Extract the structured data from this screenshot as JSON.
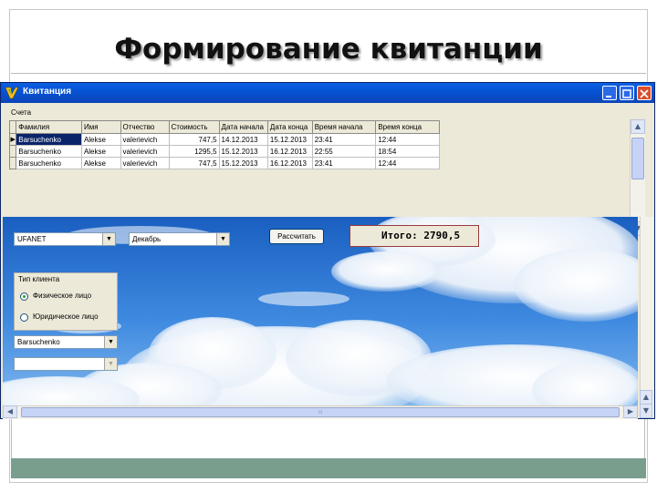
{
  "slide": {
    "title": "Формирование квитанции"
  },
  "window": {
    "title": "Квитанция",
    "min_glyph": "▁",
    "max_glyph": "□",
    "close_glyph": "✕"
  },
  "grid": {
    "label": "Счета",
    "columns": [
      "Фамилия",
      "Имя",
      "Отчество",
      "Стоимость",
      "Дата начала",
      "Дата конца",
      "Время начала",
      "Время конца"
    ],
    "rows": [
      [
        "Barsuchenko",
        "Alekse",
        "valerievich",
        "747,5",
        "14.12.2013",
        "15.12.2013",
        "23:41",
        "12:44"
      ],
      [
        "Barsuchenko",
        "Alekse",
        "valerievich",
        "1295,5",
        "15.12.2013",
        "16.12.2013",
        "22:55",
        "18:54"
      ],
      [
        "Barsuchenko",
        "Alekse",
        "valerievich",
        "747,5",
        "15.12.2013",
        "16.12.2013",
        "23:41",
        "12:44"
      ]
    ],
    "selected_indicator": "▶"
  },
  "controls": {
    "provider_combo": "UFANET",
    "month_combo": "Декабрь",
    "calc_button": "Рассчитать",
    "total_text": "Итого: 2790,5",
    "client_type_title": "Тип клиента",
    "radio_physical": "Физическое лицо",
    "radio_legal": "Юридическое лицо",
    "surname_combo": "Barsuchenko",
    "empty_combo": ""
  },
  "icons": {
    "combo_arrow": "▼",
    "scroll_up": "▲",
    "scroll_down": "▼",
    "scroll_left": "◀",
    "scroll_right": "▶",
    "grip": "⦙⦙⦙"
  },
  "colors": {
    "titlebar": "#0653d6",
    "selection": "#0a246a",
    "total_border": "#9a3a3a",
    "bottom_bar": "#7a9e8e"
  }
}
